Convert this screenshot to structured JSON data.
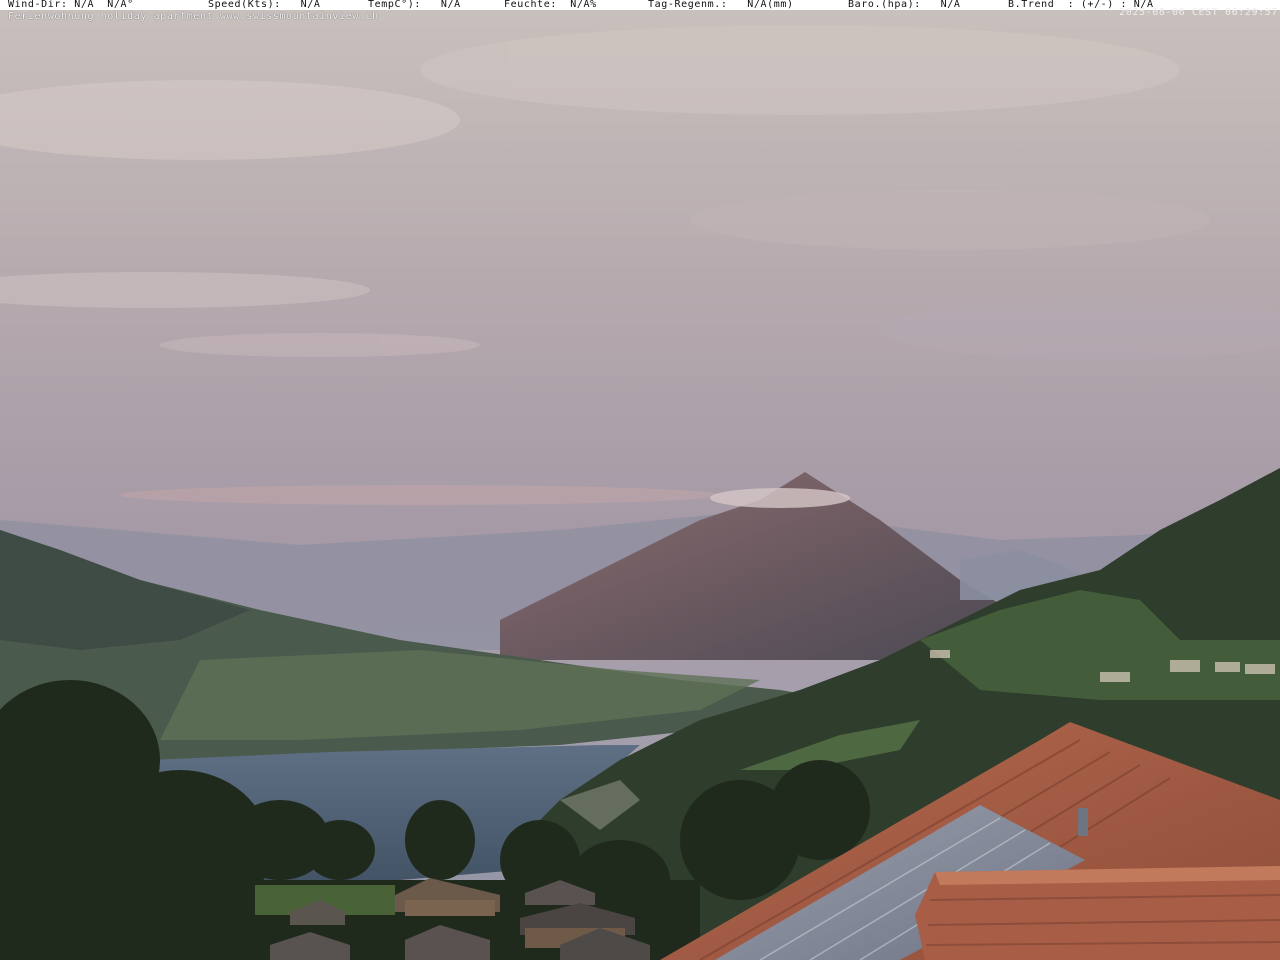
{
  "overlay": {
    "wind_dir": "Wind-Dir: N/A  N/A°",
    "speed": "Speed(Kts):   N/A",
    "temp": "TempC°):   N/A",
    "feuchte": "Feuchte:  N/A%",
    "tag_regen": "Tag-Regenm.:   N/A(mm)",
    "baro": "Baro.(hpa):   N/A",
    "btrend": "B.Trend  : (+/-) : N/A",
    "caption": "Ferienwohnung holiday apartment www.swissmountainview.ch",
    "timestamp": "2025-08-06 CEST 06:29:57"
  }
}
